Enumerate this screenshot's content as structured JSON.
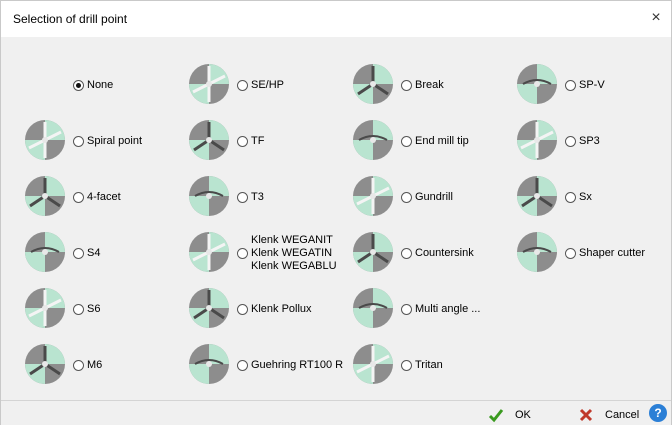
{
  "window": {
    "title": "Selection of drill point",
    "close_symbol": "×"
  },
  "selected_option": "None",
  "options": [
    [
      "None",
      "SE/HP",
      "Break",
      "SP-V"
    ],
    [
      "Spiral point",
      "TF",
      "End mill tip",
      "SP3"
    ],
    [
      "4-facet",
      "T3",
      "Gundrill",
      "Sx"
    ],
    [
      "S4",
      "Klenk WEGANIT\nKlenk WEGATIN\nKlenk WEGABLU",
      "Countersink",
      "Shaper cutter"
    ],
    [
      "S6",
      "Klenk Pollux",
      "Multi angle ...",
      ""
    ],
    [
      "M6",
      "Guehring RT100 R",
      "Tritan",
      ""
    ]
  ],
  "footer": {
    "ok_label": "OK",
    "cancel_label": "Cancel",
    "help_symbol": "?"
  }
}
